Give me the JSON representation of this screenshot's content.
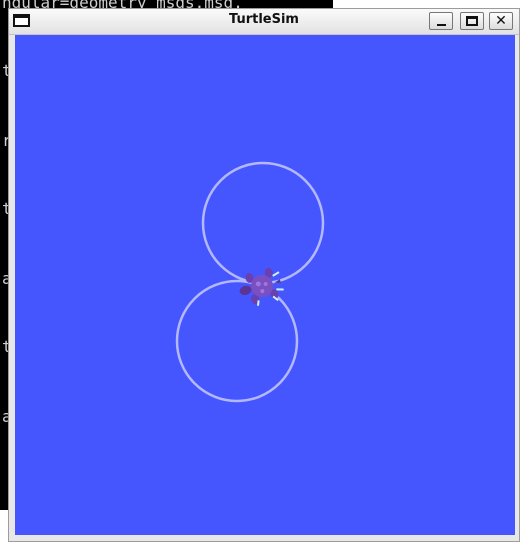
{
  "terminal": {
    "lines": [
      "ngular=geometry_msgs.msg.",
      "t",
      "r",
      "t",
      "a",
      "t",
      "a"
    ]
  },
  "window": {
    "title": "TurtleSim",
    "menu_icon": "window-menu-icon",
    "buttons": {
      "minimize": "minimize-icon",
      "maximize": "maximize-icon",
      "close": "✕"
    }
  },
  "canvas": {
    "background_color": "#4556ff",
    "path_color": "#b3b8ff",
    "turtle_color": "#7a4fc2"
  }
}
